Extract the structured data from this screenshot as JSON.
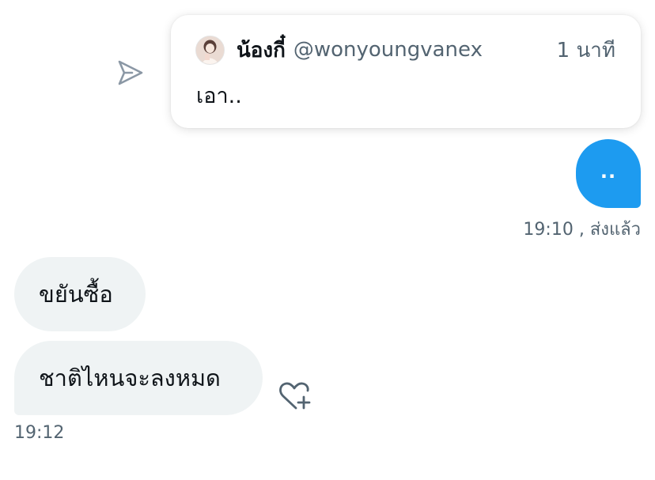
{
  "quoted_tweet": {
    "display_name": "น้องกี๋",
    "handle": "@wonyoungvanex",
    "time_ago": "1 นาที",
    "text": "เอา.."
  },
  "sent_message": {
    "text": "..",
    "time": "19:10",
    "status": ", ส่งแล้ว"
  },
  "received_messages": [
    {
      "text": "ขยันซื้อ"
    },
    {
      "text": "ชาติไหนจะลงหมด"
    }
  ],
  "received_time": "19:12",
  "icons": {
    "share": "send-icon",
    "reaction": "heart-plus-icon",
    "avatar": "profile-avatar"
  },
  "colors": {
    "accent": "#1d9bf0",
    "received_bubble": "#eff3f4",
    "secondary_text": "#536471",
    "icon_gray": "#8b98a5"
  }
}
